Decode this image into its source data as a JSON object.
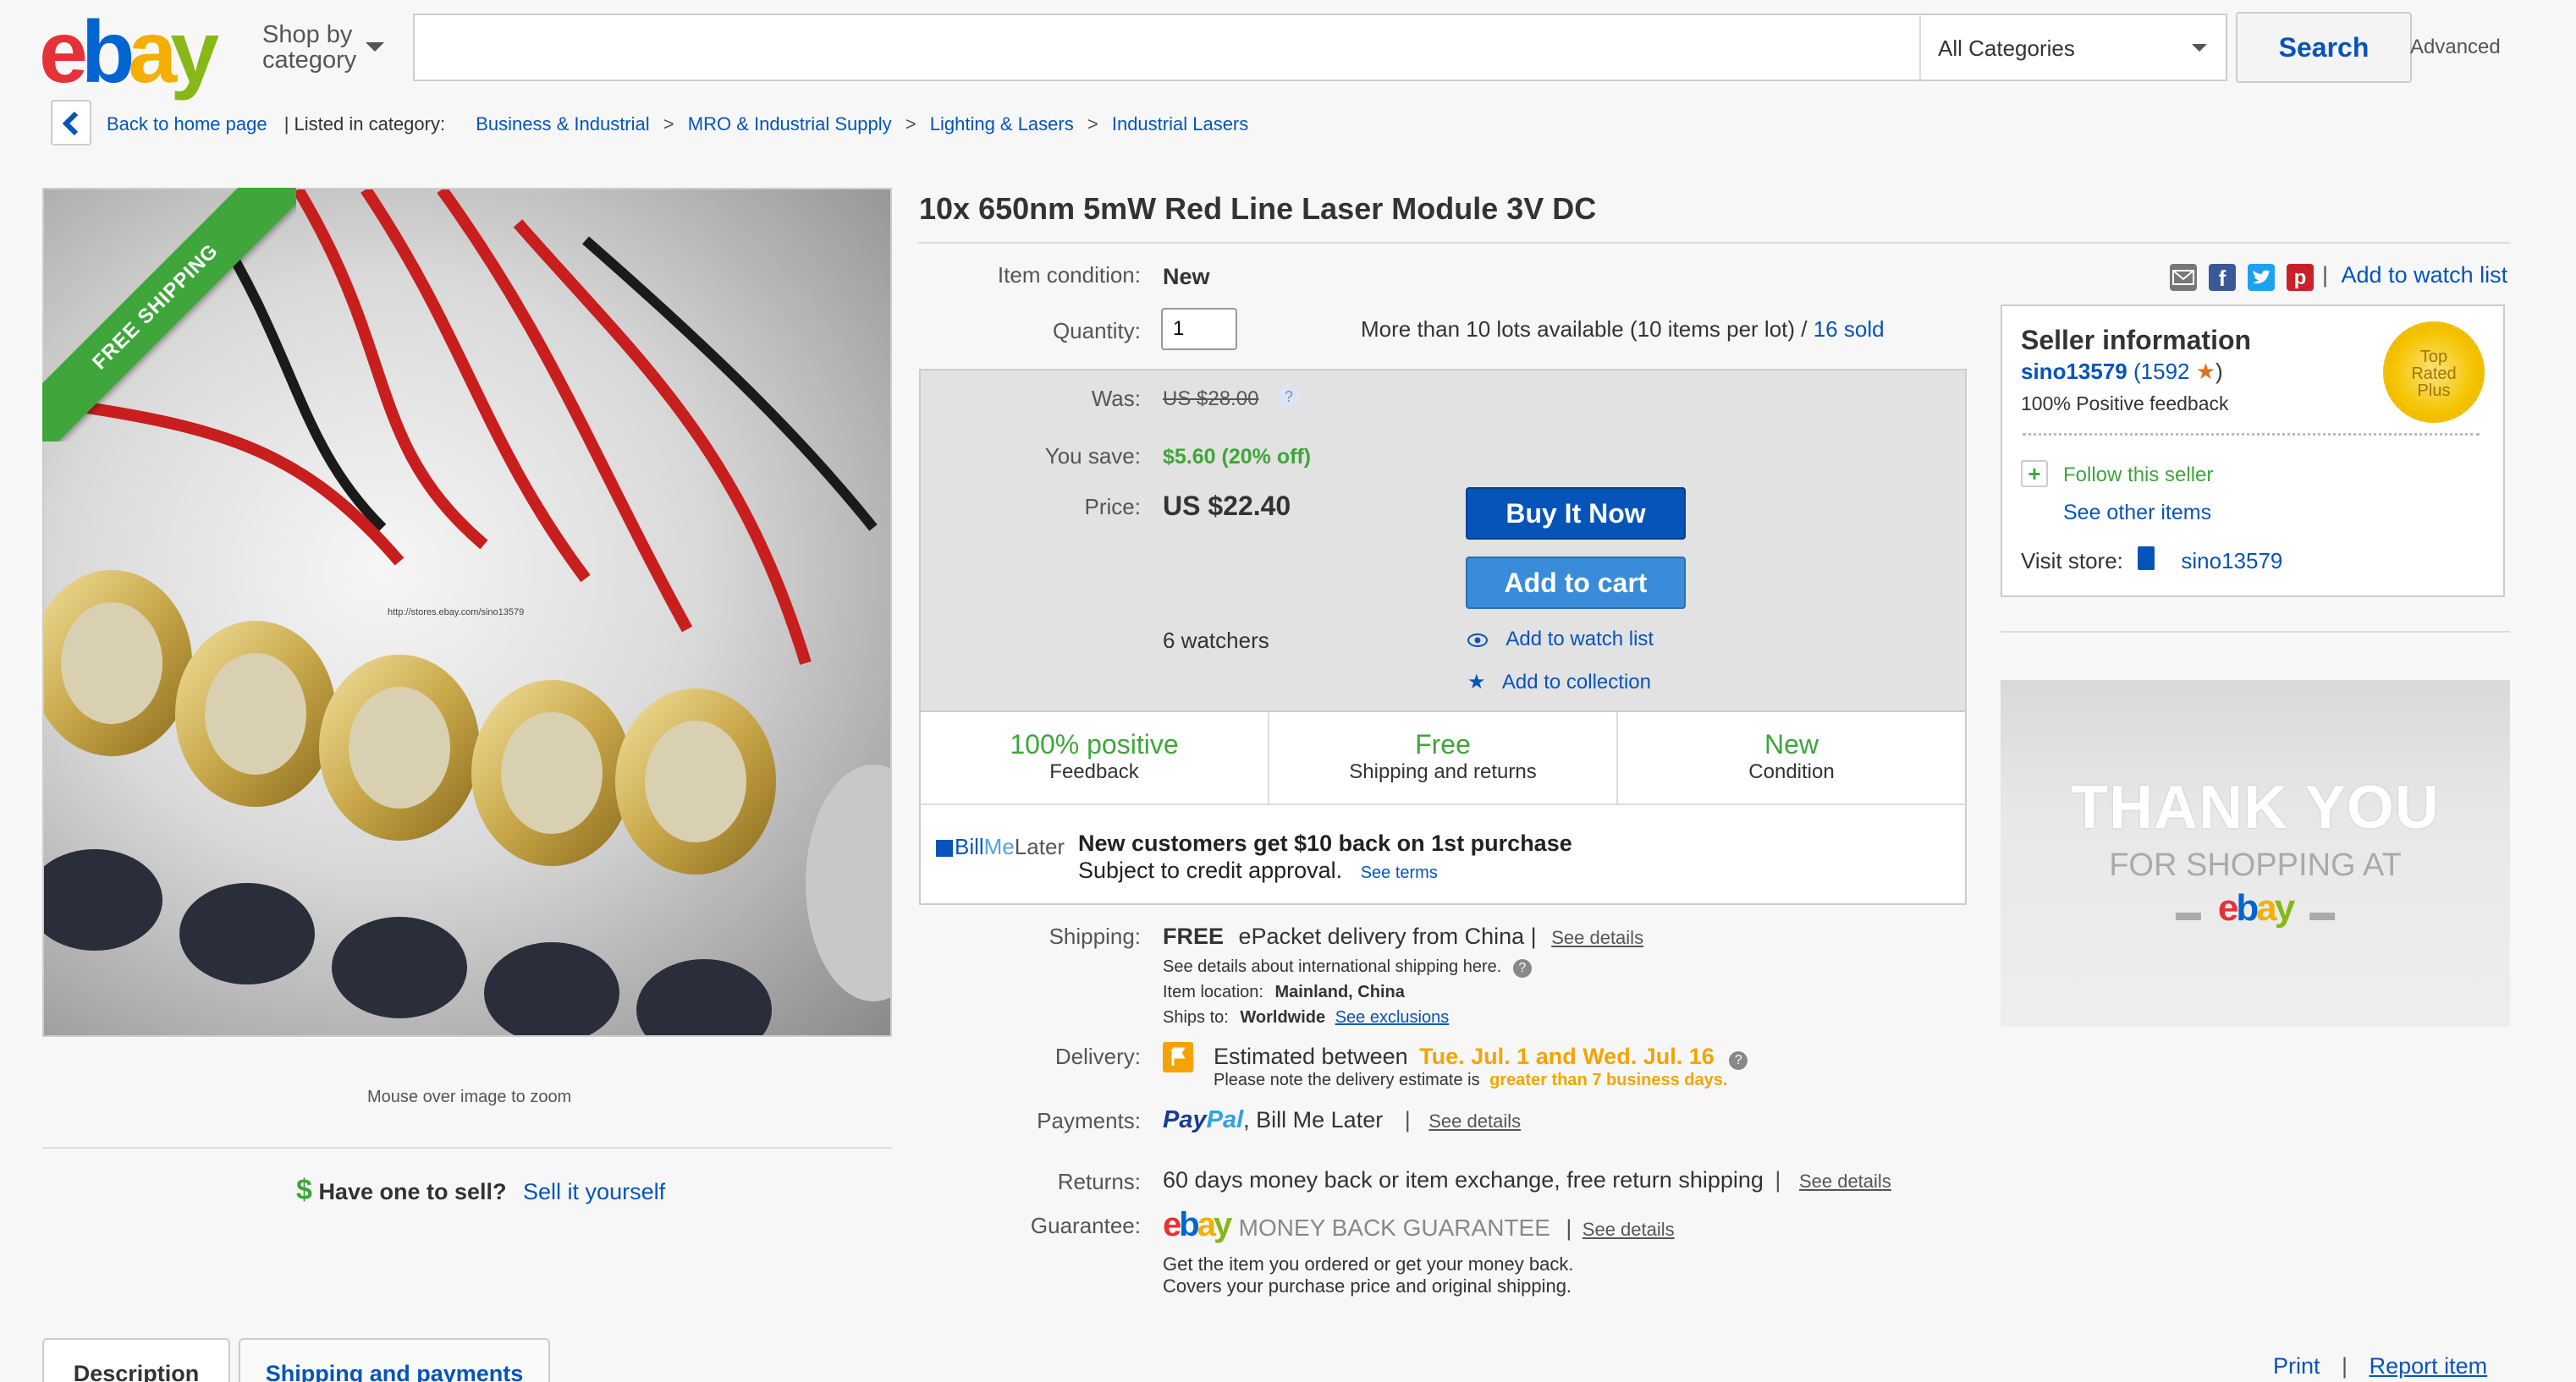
{
  "header": {
    "logo_letters": [
      "e",
      "b",
      "a",
      "y"
    ],
    "shop_by_line1": "Shop by",
    "shop_by_line2": "category",
    "search_value": "",
    "category_selected": "All Categories",
    "search_label": "Search",
    "advanced_label": "Advanced"
  },
  "breadcrumb": {
    "back_label": "Back to home page",
    "listed_label": "| Listed in category:",
    "items": [
      "Business & Industrial",
      "MRO & Industrial Supply",
      "Lighting & Lasers",
      "Industrial Lasers"
    ],
    "sep": ">"
  },
  "image": {
    "ribbon": "FREE SHIPPING",
    "zoom_hint": "Mouse over image to zoom",
    "watermark": "http://stores.ebay.com/sino13579"
  },
  "sell": {
    "dollar": "$",
    "question": "Have one to sell?",
    "link": "Sell it yourself"
  },
  "item": {
    "title": "10x 650nm 5mW Red Line Laser Module 3V DC",
    "condition_label": "Item condition:",
    "condition_value": "New",
    "quantity_label": "Quantity:",
    "quantity_value": "1",
    "availability": "More than 10 lots available (10 items per lot) /",
    "sold": "16 sold",
    "watch_link": "Add to watch list",
    "watch_sep": "|"
  },
  "price": {
    "was_label": "Was:",
    "was_value": "US $28.00",
    "save_label": "You save:",
    "save_value": "$5.60 (20% off)",
    "price_label": "Price:",
    "price_value": "US $22.40",
    "buy_now": "Buy It Now",
    "add_cart": "Add to cart",
    "watchers": "6 watchers",
    "add_watch": "Add to watch list",
    "add_collection": "Add to collection"
  },
  "badges": [
    {
      "big": "100% positive",
      "small": "Feedback"
    },
    {
      "big": "Free",
      "small": "Shipping and returns"
    },
    {
      "big": "New",
      "small": "Condition"
    }
  ],
  "bml": {
    "logo_bill": "Bill",
    "logo_me": "Me",
    "logo_later": "Later",
    "headline": "New customers get $10 back on 1st purchase",
    "sub": "Subject to credit approval.",
    "terms": "See terms"
  },
  "shipping": {
    "label": "Shipping:",
    "free": "FREE",
    "method": "ePacket delivery from China |",
    "see_details": "See details",
    "intl": "See details about international shipping here.",
    "location_label": "Item location:",
    "location": "Mainland, China",
    "ships_label": "Ships to:",
    "ships": "Worldwide",
    "exclusions": "See exclusions"
  },
  "delivery": {
    "label": "Delivery:",
    "estimated": "Estimated between",
    "dates": "Tue. Jul. 1 and Wed. Jul. 16",
    "note": "Please note the delivery estimate is",
    "note_highlight": "greater than 7 business days."
  },
  "payments": {
    "label": "Payments:",
    "paypal_pay": "Pay",
    "paypal_pal": "Pal",
    "others": ", Bill Me Later",
    "sep": "|",
    "see_details": "See details"
  },
  "returns": {
    "label": "Returns:",
    "text": "60 days money back or item exchange, free return shipping",
    "sep": "|",
    "see_details": "See details"
  },
  "guarantee": {
    "label": "Guarantee:",
    "mbg": "MONEY BACK GUARANTEE",
    "sep": "|",
    "see_details": "See details",
    "line1": "Get the item you ordered or get your money back.",
    "line2": "Covers your purchase price and original shipping."
  },
  "seller": {
    "heading": "Seller information",
    "name": "sino13579",
    "score_open": "(",
    "score": "1592",
    "score_close": ")",
    "feedback": "100% Positive feedback",
    "top_rated_1": "Top",
    "top_rated_2": "Rated",
    "top_rated_3": "Plus",
    "follow": "Follow this seller",
    "other_items": "See other items",
    "visit_label": "Visit store:",
    "store": "sino13579"
  },
  "thank_you": {
    "line1": "THANK YOU",
    "line2": "FOR SHOPPING AT",
    "logo_letters": [
      "e",
      "b",
      "a",
      "y"
    ]
  },
  "tabs": [
    "Description",
    "Shipping and payments"
  ],
  "footer": {
    "print": "Print",
    "sep": "|",
    "report": "Report item"
  },
  "colors": {
    "ebay_red": "#e53238",
    "ebay_blue": "#0064d2",
    "ebay_yellow": "#f5af02",
    "ebay_green": "#86b817",
    "link_blue": "#0654ba",
    "positive_green": "#3ea63a",
    "delivery_orange": "#f5a300"
  }
}
